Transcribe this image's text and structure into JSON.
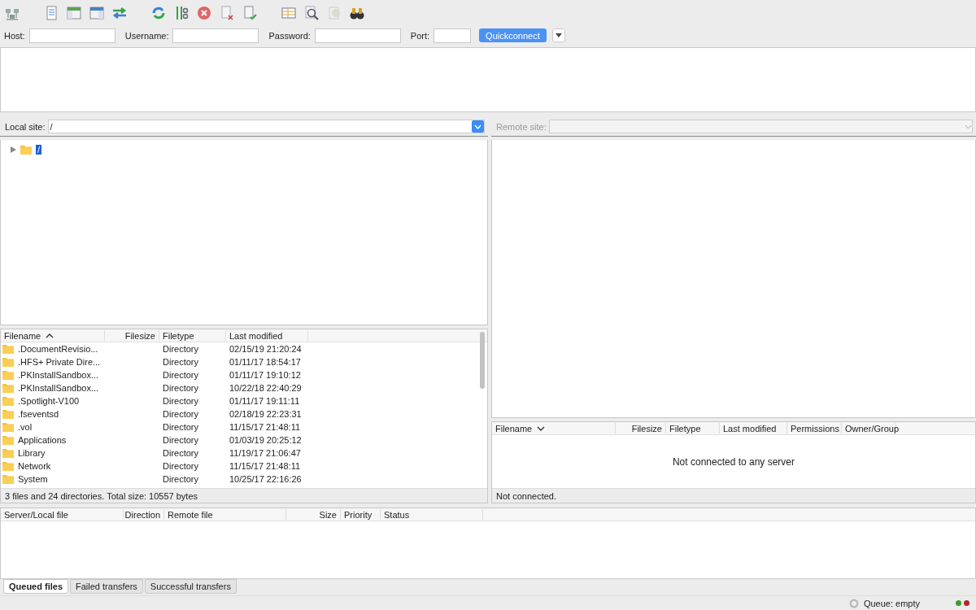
{
  "quickconnect": {
    "fields": [
      {
        "label": "Host:"
      },
      {
        "label": "Username:"
      },
      {
        "label": "Password:"
      },
      {
        "label": "Port:"
      }
    ],
    "button": "Quickconnect"
  },
  "local_site": {
    "label": "Local site:",
    "path": "/",
    "disabled": false
  },
  "local_tree": [
    {
      "label": "/",
      "selected": true,
      "expanded": false
    }
  ],
  "local_files": {
    "columns": [
      {
        "label": "Filename",
        "sort_ascending": true
      },
      {
        "label": "Filesize"
      },
      {
        "label": "Filetype"
      },
      {
        "label": "Last modified"
      }
    ],
    "rows": [
      {
        "name": ".DocumentRevisio...",
        "type": "Directory",
        "modified": "02/15/19 21:20:24"
      },
      {
        "name": ".HFS+ Private Dire...",
        "type": "Directory",
        "modified": "01/11/17 18:54:17"
      },
      {
        "name": ".PKInstallSandbox...",
        "type": "Directory",
        "modified": "01/11/17 19:10:12"
      },
      {
        "name": ".PKInstallSandbox...",
        "type": "Directory",
        "modified": "10/22/18 22:40:29"
      },
      {
        "name": ".Spotlight-V100",
        "type": "Directory",
        "modified": "01/11/17 19:11:11"
      },
      {
        "name": ".fseventsd",
        "type": "Directory",
        "modified": "02/18/19 22:23:31"
      },
      {
        "name": ".vol",
        "type": "Directory",
        "modified": "11/15/17 21:48:11"
      },
      {
        "name": "Applications",
        "type": "Directory",
        "modified": "01/03/19 20:25:12"
      },
      {
        "name": "Library",
        "type": "Directory",
        "modified": "11/19/17 21:06:47"
      },
      {
        "name": "Network",
        "type": "Directory",
        "modified": "11/15/17 21:48:11"
      },
      {
        "name": "System",
        "type": "Directory",
        "modified": "10/25/17 22:16:26"
      }
    ],
    "status": "3 files and 24 directories. Total size: 10557 bytes"
  },
  "remote_site": {
    "label": "Remote site:",
    "disabled": true
  },
  "remote_files": {
    "columns": [
      {
        "label": "Filename",
        "sort_ascending": false
      },
      {
        "label": "Filesize"
      },
      {
        "label": "Filetype"
      },
      {
        "label": "Last modified"
      },
      {
        "label": "Permissions"
      },
      {
        "label": "Owner/Group"
      }
    ],
    "message": "Not connected to any server",
    "status": "Not connected."
  },
  "queue": {
    "columns": [
      {
        "label": "Server/Local file"
      },
      {
        "label": "Direction"
      },
      {
        "label": "Remote file"
      },
      {
        "label": "Size"
      },
      {
        "label": "Priority"
      },
      {
        "label": "Status"
      }
    ]
  },
  "tabs": [
    {
      "label": "Queued files",
      "selected": true
    },
    {
      "label": "Failed transfers",
      "selected": false
    },
    {
      "label": "Successful transfers",
      "selected": false
    }
  ],
  "status_bar": {
    "queue": "Queue: empty",
    "lights": [
      {
        "color": "#3f9b2f"
      },
      {
        "color": "#b4252c"
      }
    ]
  }
}
